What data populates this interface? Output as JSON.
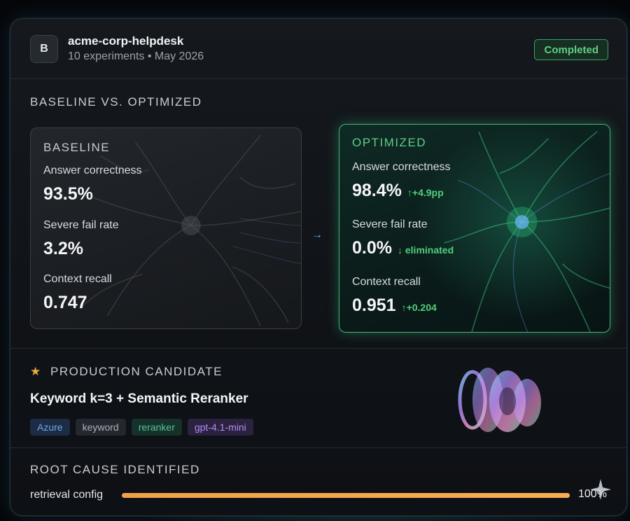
{
  "header": {
    "avatar_letter": "B",
    "project_name": "acme-corp-helpdesk",
    "meta": "10 experiments • May 2026",
    "status": "Completed"
  },
  "comparison": {
    "title": "BASELINE VS. OPTIMIZED",
    "baseline": {
      "label": "BASELINE",
      "metrics": [
        {
          "label": "Answer correctness",
          "value": "93.5%"
        },
        {
          "label": "Severe fail rate",
          "value": "3.2%"
        },
        {
          "label": "Context recall",
          "value": "0.747"
        }
      ]
    },
    "optimized": {
      "label": "OPTIMIZED",
      "metrics": [
        {
          "label": "Answer correctness",
          "value": "98.4%",
          "delta": "↑+4.9pp"
        },
        {
          "label": "Severe fail rate",
          "value": "0.0%",
          "delta": "↓ eliminated"
        },
        {
          "label": "Context recall",
          "value": "0.951",
          "delta": "↑+0.204"
        }
      ]
    }
  },
  "candidate": {
    "title": "PRODUCTION CANDIDATE",
    "name": "Keyword k=3 + Semantic Reranker",
    "tags": [
      "Azure",
      "keyword",
      "reranker",
      "gpt-4.1-mini"
    ]
  },
  "root_cause": {
    "title": "ROOT CAUSE IDENTIFIED",
    "item_label": "retrieval config",
    "percent_text": "100%",
    "fraction": 1.0
  },
  "colors": {
    "accent_green": "#4fd07a",
    "progress": "#f0a04a",
    "star": "#f0a93b"
  }
}
